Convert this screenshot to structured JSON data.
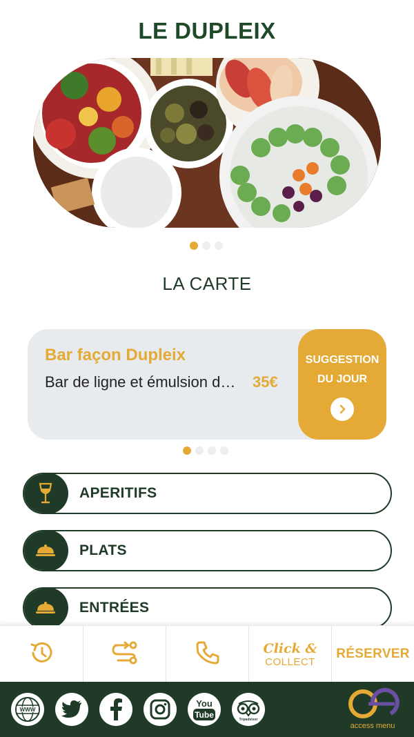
{
  "restaurant_name": "LE DUPLEIX",
  "hero": {
    "image_alt": "plateau apéritif"
  },
  "menu_section_title": "LA CARTE",
  "suggestion": {
    "dish_name": "Bar façon Dupleix",
    "description": "Bar de ligne et émulsion d…",
    "price": "35€",
    "badge_line1": "SUGGESTION",
    "badge_line2": "DU JOUR"
  },
  "categories": [
    {
      "label": "APERITIFS",
      "icon": "wine-glass-icon"
    },
    {
      "label": "PLATS",
      "icon": "cloche-icon"
    },
    {
      "label": "ENTRÉES",
      "icon": "cloche-icon"
    }
  ],
  "action_bar": {
    "history_icon": "history-icon",
    "route_icon": "route-icon",
    "phone_icon": "phone-icon",
    "click_collect_line1": "Click &",
    "click_collect_line2": "COLLECT",
    "reserve_label": "RÉSERVER"
  },
  "footer": {
    "socials": [
      "www-icon",
      "twitter-icon",
      "facebook-icon",
      "instagram-icon",
      "youtube-icon",
      "tripadvisor-icon"
    ],
    "www_text": "WWW",
    "youtube_text_1": "You",
    "youtube_text_2": "Tube",
    "tripadvisor_text": "Tripadvisor",
    "brand_name": "access menu"
  },
  "colors": {
    "primary_green": "#1f3b28",
    "accent_gold": "#e4aa35",
    "card_bg": "#e8ebee"
  }
}
